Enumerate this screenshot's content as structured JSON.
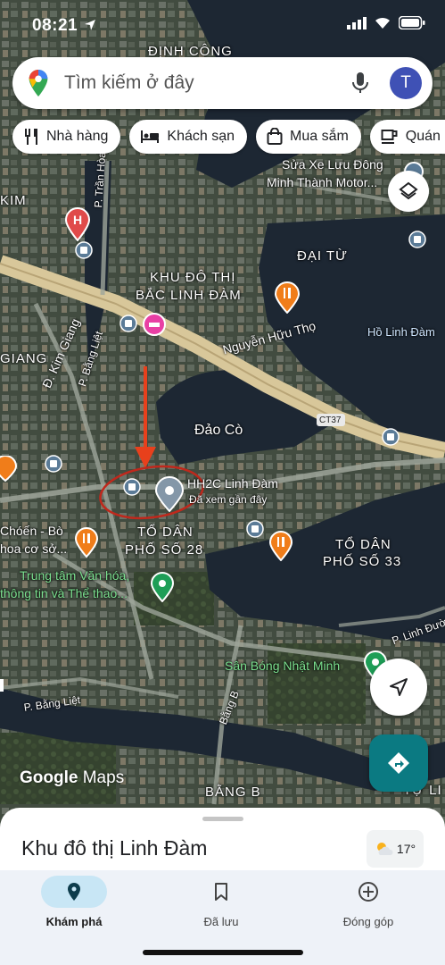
{
  "status_bar": {
    "time": "08:21"
  },
  "search": {
    "placeholder": "Tìm kiếm ở đây",
    "avatar_letter": "T"
  },
  "chips": [
    {
      "label": "Nhà hàng",
      "icon": "restaurant-icon"
    },
    {
      "label": "Khách sạn",
      "icon": "hotel-icon"
    },
    {
      "label": "Mua sắm",
      "icon": "shopping-bag-icon"
    },
    {
      "label": "Quán c",
      "icon": "coffee-icon"
    }
  ],
  "map": {
    "labels": {
      "dinh_cong": "ĐỊNH CÔNG",
      "sua_xe_1": "Sửa Xe Lưu Đông",
      "sua_xe_2": "Minh Thành Motor...",
      "kim": "KIM",
      "p_tran_hoa": "P. Trần Hòa",
      "dai_tu": "ĐẠI TỪ",
      "bac_linh_dam_1": "KHU ĐÔ THỊ",
      "bac_linh_dam_2": "BẮC LINH ĐÀM",
      "nguyen_huu_tho": "Nguyễn Hữu Thọ",
      "ho_linh_dam": "Hồ Linh Đàm",
      "kim_giang": "Đ. Kim Giang",
      "giang": "GIANG",
      "p_bang_liet_1": "P. Bằng Liệt",
      "dao_co": "Đảo Cò",
      "ct37": "CT37",
      "hh2c": "HH2C Linh Đàm",
      "da_xem": "Đã xem gần đây",
      "choen_1": "Chóến - Bò",
      "choen_2": "hoa cơ sở...",
      "to_dan_28_1": "TỔ DÂN",
      "to_dan_28_2": "PHỐ SỐ 28",
      "to_dan_33_1": "TỔ DÂN",
      "to_dan_33_2": "PHỐ SỐ 33",
      "trung_tam_1": "Trung tâm Văn hóa,",
      "trung_tam_2": "thông tin và Thể thao...",
      "p_linh_duong": "P. Linh Đườ",
      "san_bong": "Sân Bóng Nhật Minh",
      "p_bang_liet_2": "P. Bằng Liệt",
      "bang_b_road": "Bằng B",
      "bang_b": "BẰNG B",
      "tu_li": "TỰ LI"
    }
  },
  "watermark": {
    "google": "Google",
    "maps": "Maps"
  },
  "sheet": {
    "title": "Khu đô thị Linh Đàm",
    "temperature": "17°"
  },
  "nav": [
    {
      "label": "Khám phá",
      "icon": "location-pin-icon",
      "active": true
    },
    {
      "label": "Đã lưu",
      "icon": "bookmark-icon",
      "active": false
    },
    {
      "label": "Đóng góp",
      "icon": "add-circle-icon",
      "active": false
    }
  ],
  "colors": {
    "accent": "#1a73e8",
    "directions": "#0b7a82",
    "annotation": "#e8401c",
    "water": "#1d2733",
    "road_highway": "#d8c79a"
  }
}
